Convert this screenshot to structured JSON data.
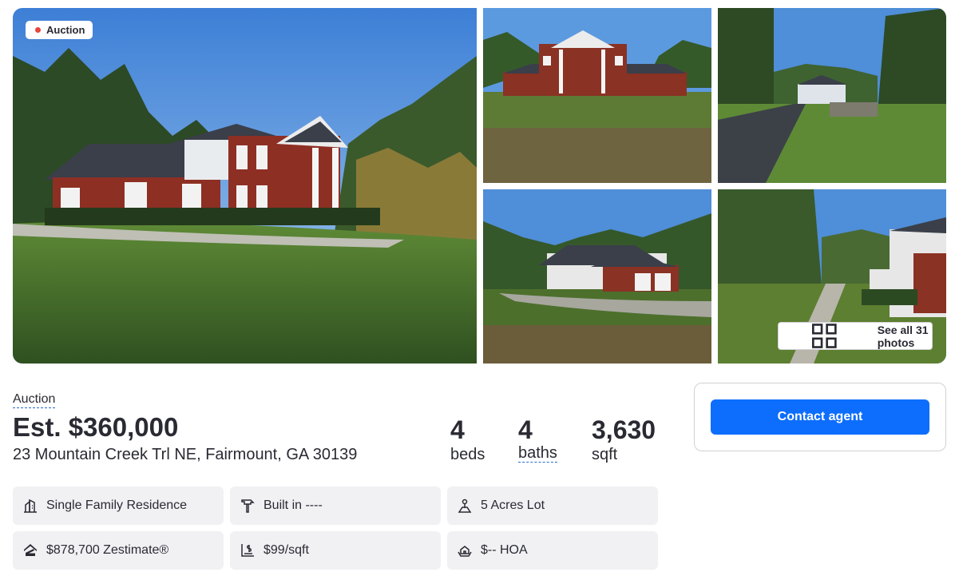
{
  "gallery": {
    "badge_label": "Auction",
    "see_all_label": "See all 31 photos"
  },
  "listing": {
    "status": "Auction",
    "price": "Est. $360,000",
    "address": "23 Mountain Creek Trl NE, Fairmount, GA 30139",
    "beds_value": "4",
    "beds_label": "beds",
    "baths_value": "4",
    "baths_label": "baths",
    "sqft_value": "3,630",
    "sqft_label": "sqft"
  },
  "facts": [
    {
      "icon": "home-type-icon",
      "text": "Single Family Residence"
    },
    {
      "icon": "hammer-icon",
      "text": "Built in ----"
    },
    {
      "icon": "lot-icon",
      "text": "5 Acres Lot"
    },
    {
      "icon": "zestimate-icon",
      "text": "$878,700 Zestimate®"
    },
    {
      "icon": "price-per-sqft-icon",
      "text": "$99/sqft"
    },
    {
      "icon": "hoa-icon",
      "text": "$-- HOA"
    }
  ],
  "contact": {
    "button_label": "Contact agent"
  },
  "colors": {
    "accent": "#0d6efd",
    "badge_dot": "#e8453c",
    "fact_bg": "#f1f1f4"
  }
}
